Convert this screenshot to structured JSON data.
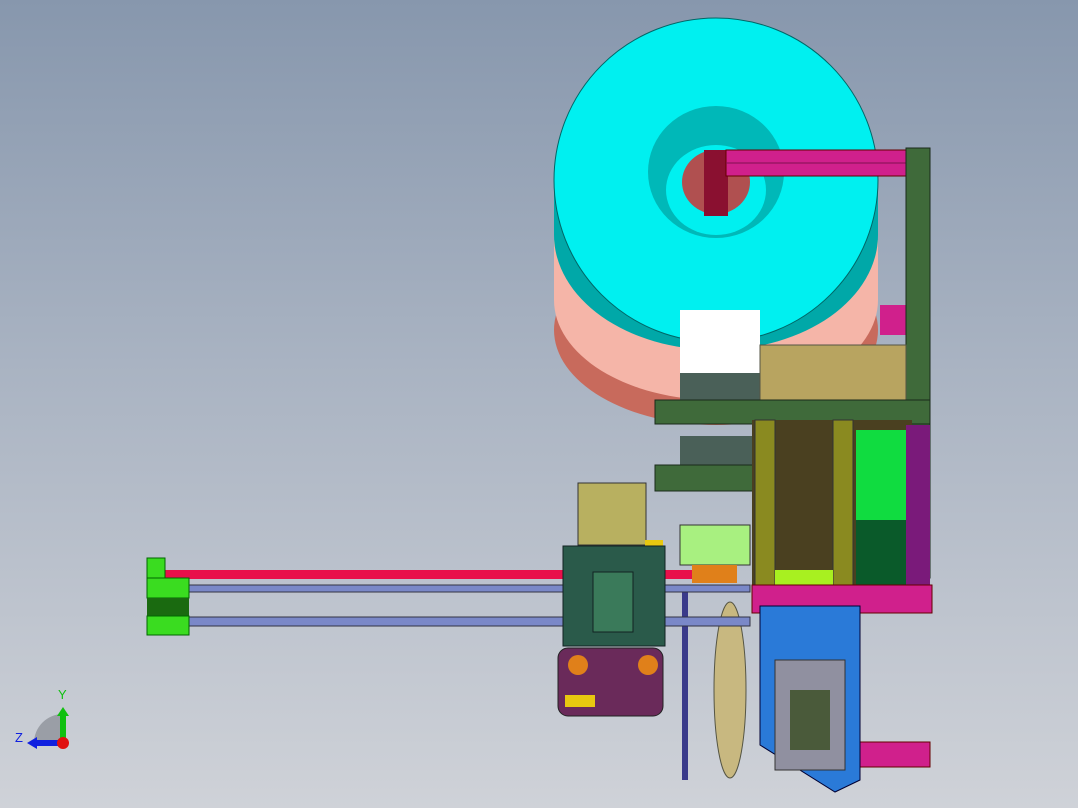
{
  "viewport": {
    "model_colors": {
      "spool_top": "#00f0f0",
      "spool_side": "#00a8a8",
      "spool_lower": "#f5b5a8",
      "frame_magenta": "#d0208c",
      "frame_green": "#3f6a3a",
      "rod_red": "#e8104a",
      "rod_blue": "#7a88c8",
      "cylinder_green": "#3adc20",
      "door_blue": "#2a7ad8"
    }
  },
  "triad": {
    "y_label": "Y",
    "z_label": "Z",
    "y_color": "#10c010",
    "z_color": "#1020e0",
    "x_color": "#e01010"
  }
}
